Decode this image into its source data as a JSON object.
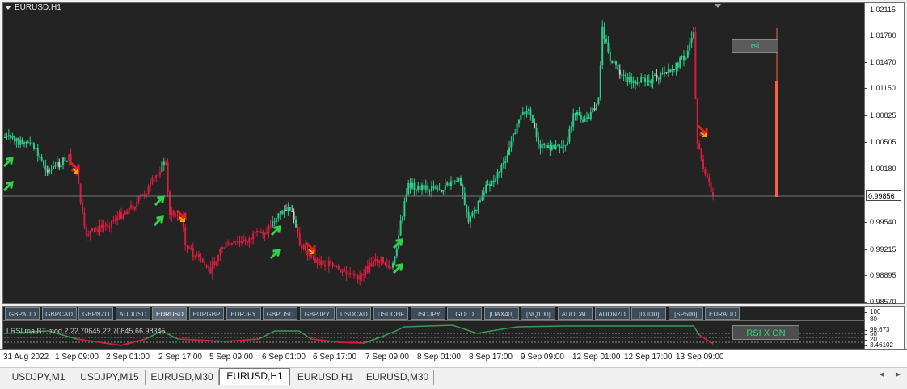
{
  "chart": {
    "title": "EURUSD,H1",
    "price_axis": [
      "1.02115",
      "1.01790",
      "1.01470",
      "1.01150",
      "1.00825",
      "1.00505",
      "1.00180",
      "0.99856",
      "0.99540",
      "0.99215",
      "0.98895",
      "0.98570"
    ],
    "current_price": "0.99856",
    "rsi_button": "rsi",
    "colors": {
      "bull": "#2ecc8a",
      "bear": "#d81e3e",
      "neutral": "#cfcfcf",
      "bg": "#232323",
      "marker": "#ff6040"
    }
  },
  "symbols": [
    {
      "label": "GBPAUD",
      "active": false
    },
    {
      "label": "GBPCAD",
      "active": false
    },
    {
      "label": "GBPNZD",
      "active": false
    },
    {
      "label": "AUDUSD",
      "active": false
    },
    {
      "label": "EURUSD",
      "active": true
    },
    {
      "label": "EURGBP",
      "active": false
    },
    {
      "label": "EURJPY",
      "active": false
    },
    {
      "label": "GBPUSD",
      "active": false
    },
    {
      "label": "GBPJPY",
      "active": false
    },
    {
      "label": "USDCAD",
      "active": false
    },
    {
      "label": "USDCHF",
      "active": false
    },
    {
      "label": "USDJPY",
      "active": false
    },
    {
      "label": "GOLD",
      "active": false
    },
    {
      "label": "[DAX40]",
      "active": false
    },
    {
      "label": "[NQ100]",
      "active": false
    },
    {
      "label": "AUDCAD",
      "active": false
    },
    {
      "label": "AUDNZD",
      "active": false
    },
    {
      "label": "[DJI30]",
      "active": false
    },
    {
      "label": "[SP500]",
      "active": false
    },
    {
      "label": "EURAUD",
      "active": false
    }
  ],
  "indicator": {
    "label": "LRSI ma BT mod 2 22.70645 22.70645 66.98345",
    "axis": [
      "100",
      "80",
      "99.673",
      "50",
      "20",
      "3.46102"
    ],
    "button": "RSI X ON"
  },
  "time_axis": [
    "31 Aug 2022",
    "1 Sep 09:00",
    "2 Sep 01:00",
    "2 Sep 17:00",
    "5 Sep 09:00",
    "6 Sep 01:00",
    "6 Sep 17:00",
    "7 Sep 09:00",
    "8 Sep 01:00",
    "8 Sep 17:00",
    "9 Sep 09:00",
    "12 Sep 01:00",
    "12 Sep 17:00",
    "13 Sep 09:00"
  ],
  "tabs": [
    {
      "label": "USDJPY,M1",
      "active": false
    },
    {
      "label": "USDJPY,M15",
      "active": false
    },
    {
      "label": "EURUSD,M30",
      "active": false
    },
    {
      "label": "EURUSD,H1",
      "active": true
    },
    {
      "label": "EURUSD,H1",
      "active": false
    },
    {
      "label": "EURUSD,M30",
      "active": false
    }
  ],
  "nav": {
    "left": "◄",
    "right": "►"
  }
}
